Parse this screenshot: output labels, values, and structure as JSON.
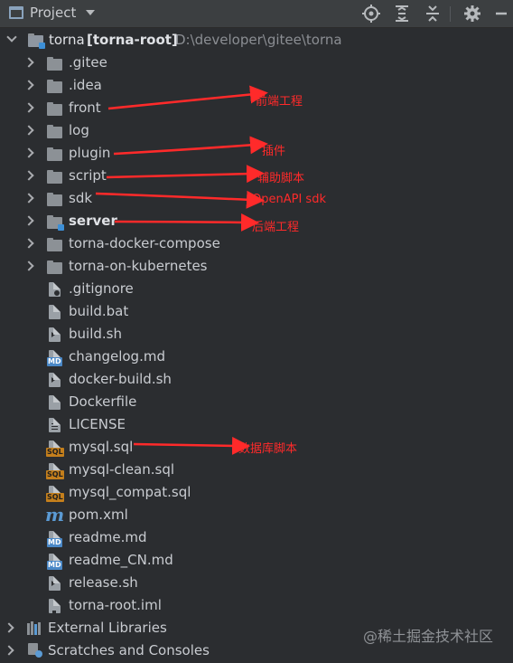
{
  "toolbar": {
    "title": "Project"
  },
  "root": {
    "name": "torna",
    "module": "[torna-root]",
    "path": "D:\\developer\\gitee\\torna"
  },
  "folders": [
    {
      "name": ".gitee"
    },
    {
      "name": ".idea"
    },
    {
      "name": "front"
    },
    {
      "name": "log"
    },
    {
      "name": "plugin"
    },
    {
      "name": "script"
    },
    {
      "name": "sdk"
    },
    {
      "name": "server"
    },
    {
      "name": "torna-docker-compose"
    },
    {
      "name": "torna-on-kubernetes"
    }
  ],
  "files": [
    {
      "name": ".gitignore",
      "icon": "gitignore-icon"
    },
    {
      "name": "build.bat",
      "icon": "bat-file-icon"
    },
    {
      "name": "build.sh",
      "icon": "shell-file-icon"
    },
    {
      "name": "changelog.md",
      "icon": "markdown-file-icon",
      "badge": "MD"
    },
    {
      "name": "docker-build.sh",
      "icon": "shell-file-icon"
    },
    {
      "name": "Dockerfile",
      "icon": "docker-file-icon"
    },
    {
      "name": "LICENSE",
      "icon": "text-file-icon"
    },
    {
      "name": "mysql.sql",
      "icon": "sql-file-icon",
      "badge": "SQL"
    },
    {
      "name": "mysql-clean.sql",
      "icon": "sql-file-icon",
      "badge": "SQL"
    },
    {
      "name": "mysql_compat.sql",
      "icon": "sql-file-icon",
      "badge": "SQL"
    },
    {
      "name": "pom.xml",
      "icon": "maven-icon",
      "badge": "m"
    },
    {
      "name": "readme.md",
      "icon": "markdown-file-icon",
      "badge": "MD"
    },
    {
      "name": "readme_CN.md",
      "icon": "markdown-file-icon",
      "badge": "MD"
    },
    {
      "name": "release.sh",
      "icon": "shell-file-icon"
    },
    {
      "name": "torna-root.iml",
      "icon": "iml-file-icon"
    }
  ],
  "bottom": [
    {
      "name": "External Libraries"
    },
    {
      "name": "Scratches and Consoles"
    }
  ],
  "annotations": {
    "front": "前端工程",
    "plugin": "插件",
    "script": "辅助脚本",
    "sdk": "OpenAPI sdk",
    "server": "后端工程",
    "mysql": "数据库脚本"
  },
  "watermark": "@稀土掘金技术社区",
  "colors": {
    "background": "#2b2d30",
    "toolbar": "#3c3f41",
    "annotation": "#ff2a2a",
    "sql_badge": "#c47f1c",
    "md_badge": "#4a88c7"
  }
}
